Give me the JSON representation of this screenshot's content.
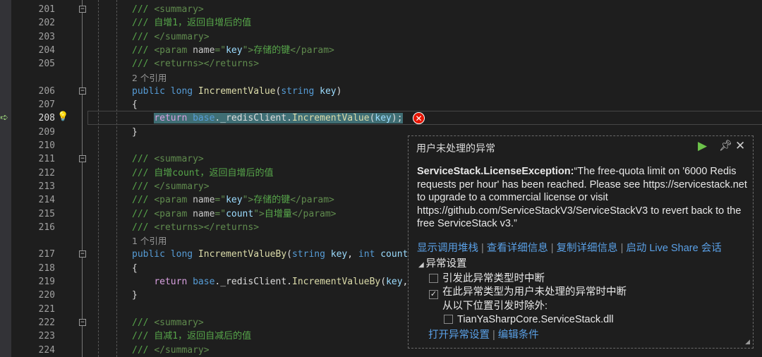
{
  "editor": {
    "rows": [
      {
        "n": "201",
        "fold": true,
        "html": [
          [
            "c",
            "/// "
          ],
          [
            "t",
            "<summary>"
          ]
        ]
      },
      {
        "n": "202",
        "html": [
          [
            "c",
            "/// 自增1，返回自增后的值"
          ]
        ]
      },
      {
        "n": "203",
        "html": [
          [
            "c",
            "/// "
          ],
          [
            "t",
            "</summary>"
          ]
        ]
      },
      {
        "n": "204",
        "html": [
          [
            "c",
            "/// "
          ],
          [
            "t",
            "<param "
          ],
          [
            "a",
            "name"
          ],
          [
            "t",
            "=\""
          ],
          [
            "v",
            "key"
          ],
          [
            "t",
            "\">"
          ],
          [
            "c",
            "存储的键"
          ],
          [
            "t",
            "</param>"
          ]
        ]
      },
      {
        "n": "205",
        "html": [
          [
            "c",
            "/// "
          ],
          [
            "t",
            "<returns></returns>"
          ]
        ]
      },
      {
        "lens": "2 个引用"
      },
      {
        "n": "206",
        "fold": true,
        "html": [
          [
            "k",
            "public long "
          ],
          [
            "m",
            "IncrementValue"
          ],
          [
            "d",
            "("
          ],
          [
            "k",
            "string "
          ],
          [
            "v",
            "key"
          ],
          [
            "d",
            ")"
          ]
        ]
      },
      {
        "n": "207",
        "html": [
          [
            "d",
            "{"
          ]
        ]
      },
      {
        "n": "208",
        "cur": true,
        "html": [
          [
            "d",
            "    "
          ],
          [
            "p",
            "return "
          ],
          [
            "k",
            "base"
          ],
          [
            "d",
            "._redisClient."
          ],
          [
            "m",
            "IncrementValue"
          ],
          [
            "d",
            "("
          ],
          [
            "v",
            "key"
          ],
          [
            "d",
            ");"
          ]
        ]
      },
      {
        "n": "209",
        "html": [
          [
            "d",
            "}"
          ]
        ]
      },
      {
        "n": "210",
        "html": []
      },
      {
        "n": "211",
        "fold": true,
        "html": [
          [
            "c",
            "/// "
          ],
          [
            "t",
            "<summary>"
          ]
        ]
      },
      {
        "n": "212",
        "html": [
          [
            "c",
            "/// 自增count，返回自增后的值"
          ]
        ]
      },
      {
        "n": "213",
        "html": [
          [
            "c",
            "/// "
          ],
          [
            "t",
            "</summary>"
          ]
        ]
      },
      {
        "n": "214",
        "html": [
          [
            "c",
            "/// "
          ],
          [
            "t",
            "<param "
          ],
          [
            "a",
            "name"
          ],
          [
            "t",
            "=\""
          ],
          [
            "v",
            "key"
          ],
          [
            "t",
            "\">"
          ],
          [
            "c",
            "存储的键"
          ],
          [
            "t",
            "</param>"
          ]
        ]
      },
      {
        "n": "215",
        "html": [
          [
            "c",
            "/// "
          ],
          [
            "t",
            "<param "
          ],
          [
            "a",
            "name"
          ],
          [
            "t",
            "=\""
          ],
          [
            "v",
            "count"
          ],
          [
            "t",
            "\">"
          ],
          [
            "c",
            "自增量"
          ],
          [
            "t",
            "</param>"
          ]
        ]
      },
      {
        "n": "216",
        "html": [
          [
            "c",
            "/// "
          ],
          [
            "t",
            "<returns></returns>"
          ]
        ]
      },
      {
        "lens": "1 个引用"
      },
      {
        "n": "217",
        "fold": true,
        "html": [
          [
            "k",
            "public long "
          ],
          [
            "m",
            "IncrementValueBy"
          ],
          [
            "d",
            "("
          ],
          [
            "k",
            "string "
          ],
          [
            "v",
            "key"
          ],
          [
            "d",
            ", "
          ],
          [
            "k",
            "int "
          ],
          [
            "v",
            "count"
          ],
          [
            "d",
            ")"
          ]
        ]
      },
      {
        "n": "218",
        "html": [
          [
            "d",
            "{"
          ]
        ]
      },
      {
        "n": "219",
        "html": [
          [
            "d",
            "    "
          ],
          [
            "p",
            "return "
          ],
          [
            "k",
            "base"
          ],
          [
            "d",
            "._redisClient."
          ],
          [
            "m",
            "IncrementValueBy"
          ],
          [
            "d",
            "("
          ],
          [
            "v",
            "key"
          ],
          [
            "d",
            ", "
          ],
          [
            "v",
            "count"
          ],
          [
            "d",
            ");"
          ]
        ]
      },
      {
        "n": "220",
        "html": [
          [
            "d",
            "}"
          ]
        ]
      },
      {
        "n": "221",
        "html": []
      },
      {
        "n": "222",
        "fold": true,
        "html": [
          [
            "c",
            "/// "
          ],
          [
            "t",
            "<summary>"
          ]
        ]
      },
      {
        "n": "223",
        "html": [
          [
            "c",
            "/// 自减1，返回自减后的值"
          ]
        ]
      },
      {
        "n": "224",
        "html": [
          [
            "c",
            "/// "
          ],
          [
            "t",
            "</summary>"
          ]
        ]
      }
    ]
  },
  "popup": {
    "title": "用户未处理的异常",
    "exception_type": "ServiceStack.LicenseException:",
    "message": "“The free-quota limit on '6000 Redis requests per hour' has been reached. Please see https://servicestack.net to upgrade to a commercial license or visit https://github.com/ServiceStackV3/ServiceStackV3 to revert back to the free ServiceStack v3.”",
    "links": [
      "显示调用堆栈",
      "查看详细信息",
      "复制详细信息",
      "启动 Live Share 会话"
    ],
    "settings": {
      "header": "异常设置",
      "break_when_thrown": {
        "label": "引发此异常类型时中断",
        "checked": false
      },
      "break_when_unhandled": {
        "label": "在此异常类型为用户未处理的异常时中断",
        "checked": true
      },
      "except_label": "从以下位置引发时除外:",
      "module": {
        "label": "TianYaSharpCore.ServiceStack.dll",
        "checked": false
      }
    },
    "bottom_links": [
      "打开异常设置",
      "编辑条件"
    ]
  }
}
